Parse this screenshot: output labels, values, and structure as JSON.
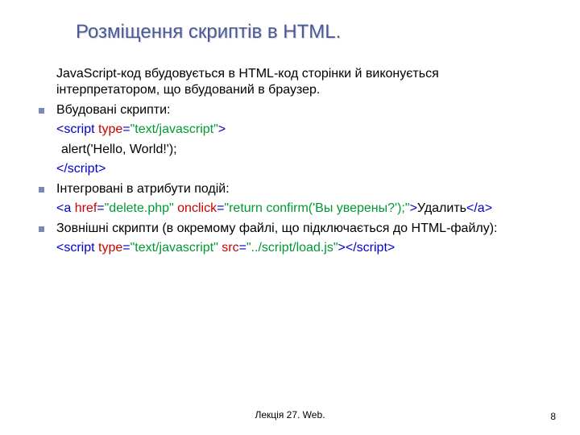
{
  "title": "Розміщення скриптів в HTML.",
  "intro": "JavaScript-код вбудовується в HTML-код сторінки й виконується інтерпретатором, що вбудований в браузер.",
  "bullets": [
    {
      "label": "Вбудовані скрипти:",
      "code_lines": [
        {
          "parts": [
            {
              "t": "<",
              "cls": "tag"
            },
            {
              "t": "script ",
              "cls": "tag"
            },
            {
              "t": "type",
              "cls": "attr"
            },
            {
              "t": "=",
              "cls": "tag"
            },
            {
              "t": "\"text/javascript\"",
              "cls": "val"
            },
            {
              "t": ">",
              "cls": "tag"
            }
          ]
        },
        {
          "indent2": true,
          "parts": [
            {
              "t": "alert('Hello, World!');",
              "cls": ""
            }
          ]
        },
        {
          "parts": [
            {
              "t": "<",
              "cls": "tag"
            },
            {
              "t": "/script",
              "cls": "tag"
            },
            {
              "t": ">",
              "cls": "tag"
            }
          ]
        }
      ]
    },
    {
      "label": "Інтегровані в атрибути подій:",
      "code_lines": [
        {
          "parts": [
            {
              "t": "<",
              "cls": "tag"
            },
            {
              "t": "a ",
              "cls": "tag"
            },
            {
              "t": "href",
              "cls": "attr"
            },
            {
              "t": "=",
              "cls": "tag"
            },
            {
              "t": "\"delete.php\"",
              "cls": "val"
            },
            {
              "t": " ",
              "cls": ""
            },
            {
              "t": "onclick",
              "cls": "attr"
            },
            {
              "t": "=",
              "cls": "tag"
            },
            {
              "t": "\"",
              "cls": "val"
            },
            {
              "t": "return",
              "cls": "ret"
            },
            {
              "t": " confirm('Вы уверены?');",
              "cls": "val"
            },
            {
              "t": "\"",
              "cls": "val"
            },
            {
              "t": ">",
              "cls": "tag"
            },
            {
              "t": "Удалить",
              "cls": ""
            },
            {
              "t": "<",
              "cls": "tag"
            },
            {
              "t": "/a",
              "cls": "tag"
            },
            {
              "t": ">",
              "cls": "tag"
            }
          ]
        }
      ]
    },
    {
      "label": "Зовнішні скрипти (в окремому файлі, що підключається до HTML-файлу):",
      "code_lines": [
        {
          "parts": [
            {
              "t": "<",
              "cls": "tag"
            },
            {
              "t": "script ",
              "cls": "tag"
            },
            {
              "t": "type",
              "cls": "attr"
            },
            {
              "t": "=",
              "cls": "tag"
            },
            {
              "t": "\"text/javascript\"",
              "cls": "val"
            },
            {
              "t": " ",
              "cls": ""
            },
            {
              "t": "src",
              "cls": "attr"
            },
            {
              "t": "=",
              "cls": "tag"
            },
            {
              "t": "\"../script/load.js\"",
              "cls": "val"
            },
            {
              "t": ">",
              "cls": "tag"
            },
            {
              "t": "<",
              "cls": "tag"
            },
            {
              "t": "/script",
              "cls": "tag"
            },
            {
              "t": ">",
              "cls": "tag"
            }
          ]
        }
      ]
    }
  ],
  "footer": "Лекція 27. Web.",
  "page": "8"
}
